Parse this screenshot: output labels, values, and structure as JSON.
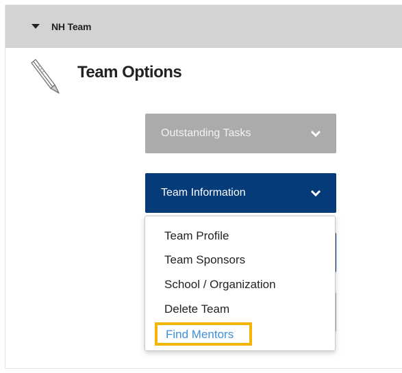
{
  "panel": {
    "header_label": "NH Team"
  },
  "section": {
    "title": "Team Options",
    "icon": "pen-icon"
  },
  "accordions": {
    "outstanding_tasks": "Outstanding Tasks",
    "team_information": "Team Information"
  },
  "dropdown": {
    "items": [
      "Team Profile",
      "Team Sponsors",
      "School / Organization",
      "Delete Team",
      "Find Mentors"
    ],
    "highlighted_item": "Find Mentors",
    "highlight_color": "#f5b400",
    "link_color": "#3f8fd9"
  },
  "colors": {
    "header_bg": "#d3d3d3",
    "primary": "#053b79",
    "disabled": "#ababab"
  }
}
